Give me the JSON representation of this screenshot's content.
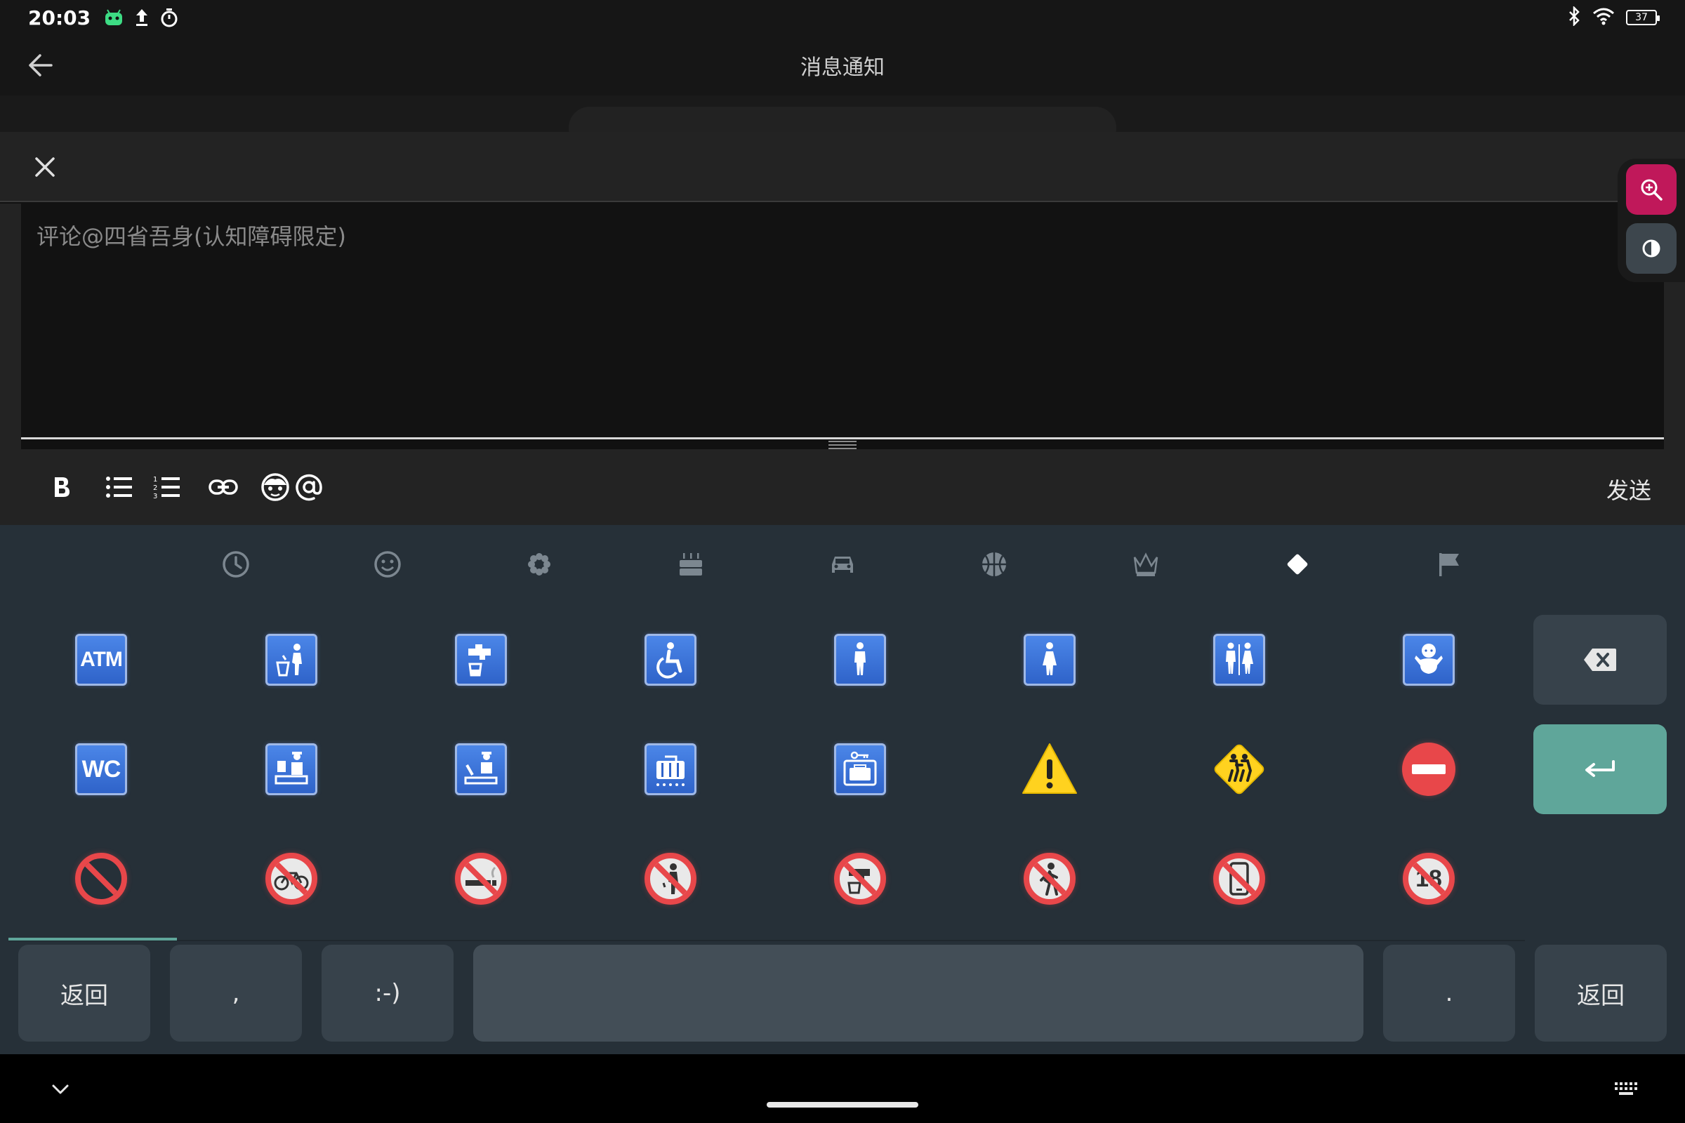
{
  "status_bar": {
    "time": "20:03",
    "battery": "37"
  },
  "header": {
    "title": "消息通知"
  },
  "comment": {
    "placeholder": "评论@四省吾身(认知障碍限定)"
  },
  "toolbar": {
    "send_label": "发送"
  },
  "keyboard": {
    "categories": [
      "recent-icon",
      "smiley-icon",
      "nature-icon",
      "food-icon",
      "car-icon",
      "activity-icon",
      "objects-icon",
      "symbols-icon",
      "flags-icon"
    ],
    "selected_category": "symbols-icon",
    "row1": [
      "ATM",
      "put-litter-in-its-place",
      "potable-water",
      "wheelchair-symbol",
      "mens-room",
      "womens-room",
      "restroom",
      "baby-symbol"
    ],
    "row2": [
      "WC",
      "passport-control",
      "customs",
      "baggage-claim",
      "left-luggage",
      "warning",
      "children-crossing",
      "no-entry"
    ],
    "row3": [
      "prohibited",
      "no-bicycles",
      "no-smoking",
      "no-littering",
      "non-potable-water",
      "no-pedestrians",
      "no-mobile-phones",
      "no-one-under-eighteen"
    ],
    "bottom_keys": {
      "back_left": "返回",
      "comma": ",",
      "smiley": ":-)",
      "period": ".",
      "back_right": "返回"
    },
    "sign_labels": {
      "atm": "ATM",
      "wc": "WC",
      "under18": "18"
    }
  }
}
